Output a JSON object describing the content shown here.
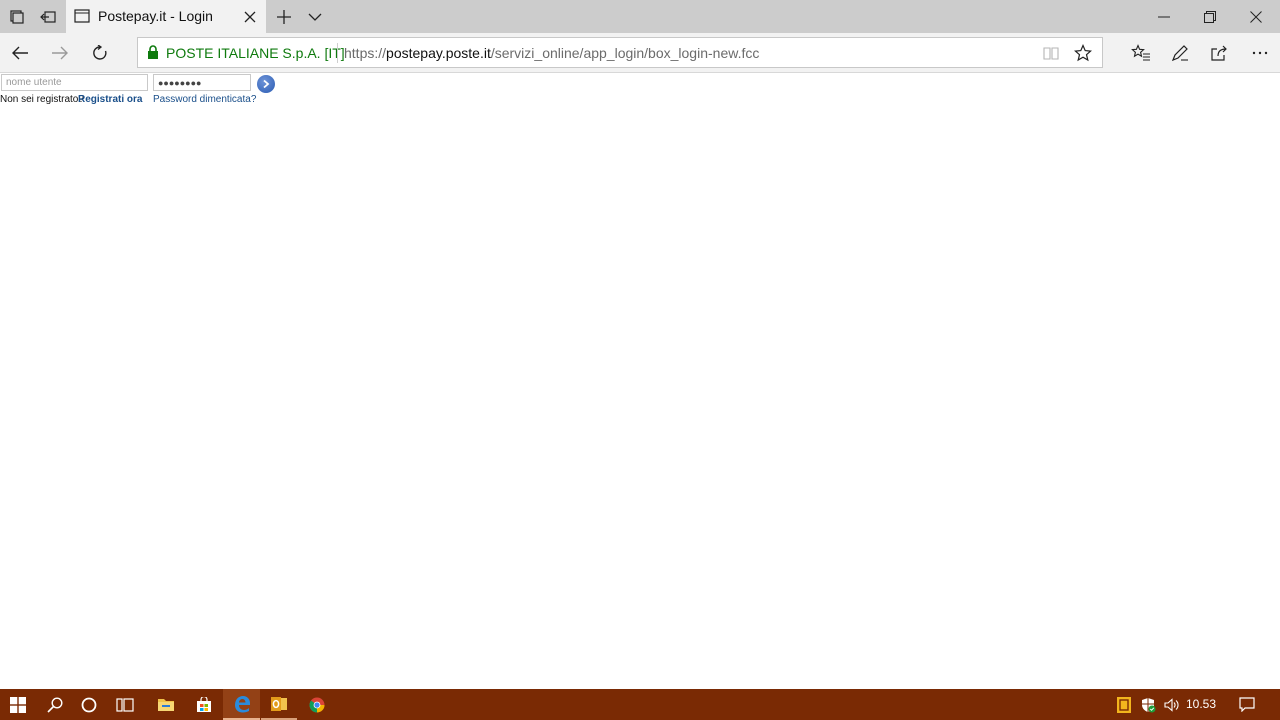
{
  "browser": {
    "tab": {
      "title": "Postepay.it - Login"
    },
    "address": {
      "certificate": "POSTE ITALIANE S.p.A. [IT]",
      "url_scheme": "https://",
      "url_host": "postepay.poste.it",
      "url_path": "/servizi_online/app_login/box_login-new.fcc"
    }
  },
  "login": {
    "username_placeholder": "nome utente",
    "username_value": "",
    "password_value": "●●●●●●●●",
    "not_registered_text": "Non sei registrato?",
    "register_link": "Registrati ora",
    "forgot_password_link": "Password dimenticata?",
    "link_color": "#1a4f8a"
  },
  "taskbar": {
    "clock": "10.53",
    "background": "#7a2a04"
  }
}
